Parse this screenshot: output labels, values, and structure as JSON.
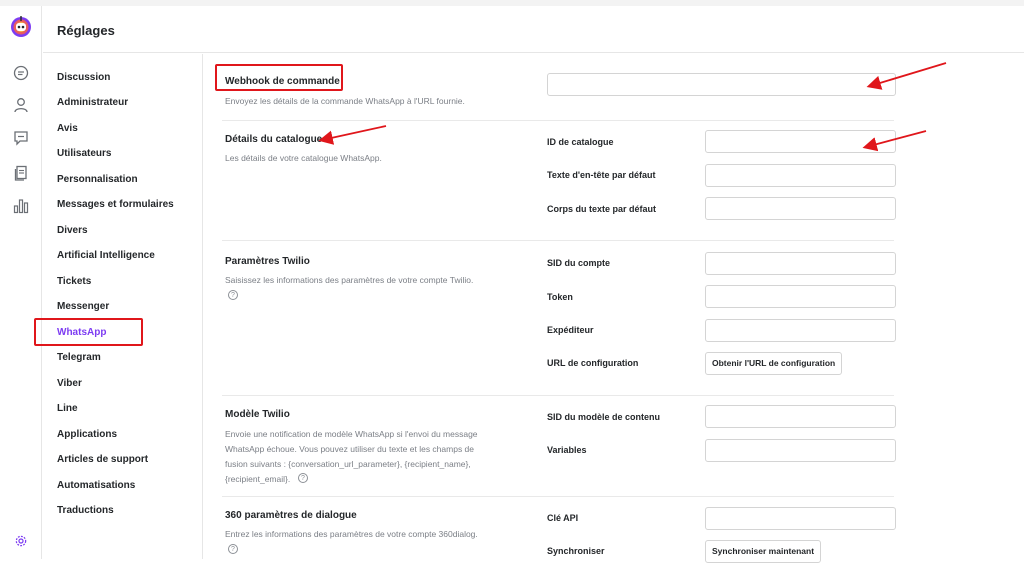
{
  "header": {
    "title": "Réglages"
  },
  "rail": {
    "icons": [
      "logo-icon",
      "chat-icon",
      "user-icon",
      "comment-icon",
      "docs-icon",
      "chart-icon",
      "settings-icon"
    ]
  },
  "sidebar": {
    "items": [
      {
        "label": "Discussion"
      },
      {
        "label": "Administrateur"
      },
      {
        "label": "Avis"
      },
      {
        "label": "Utilisateurs"
      },
      {
        "label": "Personnalisation"
      },
      {
        "label": "Messages et formulaires"
      },
      {
        "label": "Divers"
      },
      {
        "label": "Artificial Intelligence"
      },
      {
        "label": "Tickets"
      },
      {
        "label": "Messenger"
      },
      {
        "label": "WhatsApp"
      },
      {
        "label": "Telegram"
      },
      {
        "label": "Viber"
      },
      {
        "label": "Line"
      },
      {
        "label": "Applications"
      },
      {
        "label": "Articles de support"
      },
      {
        "label": "Automatisations"
      },
      {
        "label": "Traductions"
      }
    ],
    "active": "WhatsApp"
  },
  "sections": {
    "webhook": {
      "title": "Webhook de commande",
      "desc": "Envoyez les détails de la commande WhatsApp à l'URL fournie."
    },
    "catalogue": {
      "title": "Détails du catalogue",
      "desc": "Les détails de votre catalogue WhatsApp.",
      "fields": [
        "ID de catalogue",
        "Texte d'en-tête par défaut",
        "Corps du texte par défaut"
      ]
    },
    "twilio": {
      "title": "Paramètres Twilio",
      "desc": "Saisissez les informations des paramètres de votre compte Twilio.",
      "fields": [
        "SID du compte",
        "Token",
        "Expéditeur",
        "URL de configuration"
      ],
      "button": "Obtenir l'URL de configuration"
    },
    "twilio_template": {
      "title": "Modèle Twilio",
      "desc_lines": [
        "Envoie une notification de modèle WhatsApp si l'envoi du message",
        "WhatsApp échoue. Vous pouvez utiliser du texte et les champs de",
        "fusion suivants : {conversation_url_parameter}, {recipient_name},",
        "{recipient_email}."
      ],
      "fields": [
        "SID du modèle de contenu",
        "Variables"
      ]
    },
    "dialog360": {
      "title": "360 paramètres de dialogue",
      "desc": "Entrez les informations des paramètres de votre compte 360dialog.",
      "fields": [
        "Clé API",
        "Synchroniser"
      ],
      "button": "Synchroniser maintenant"
    }
  },
  "colors": {
    "accent": "#7d3cf2",
    "highlight": "#e0161b"
  }
}
